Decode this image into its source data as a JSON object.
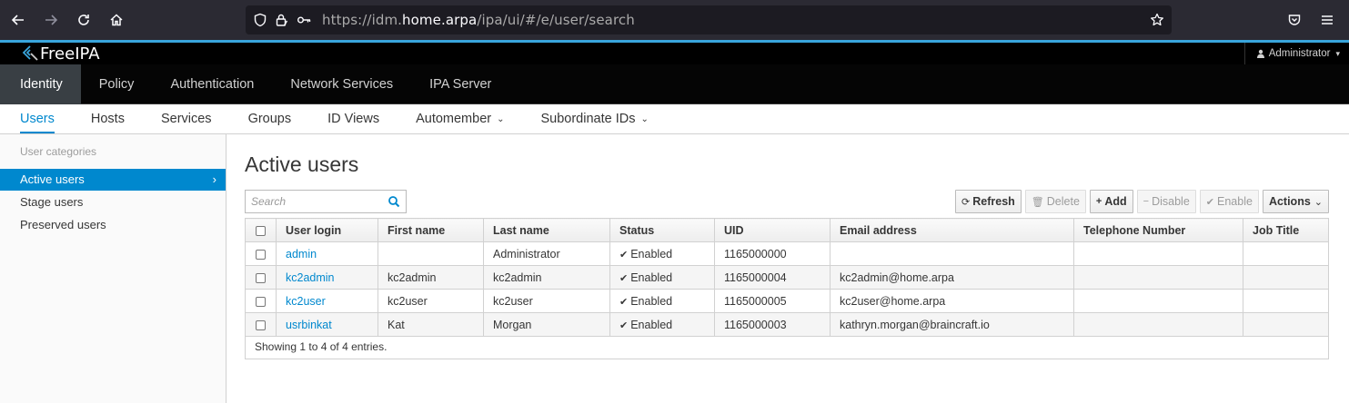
{
  "browser": {
    "url_prefix": "https://idm.",
    "url_domain": "home.arpa",
    "url_path": "/ipa/ui/#/e/user/search"
  },
  "app": {
    "logo_text": "FreeIPA",
    "user_menu": "Administrator"
  },
  "topnav": [
    "Identity",
    "Policy",
    "Authentication",
    "Network Services",
    "IPA Server"
  ],
  "subnav": {
    "users": "Users",
    "hosts": "Hosts",
    "services": "Services",
    "groups": "Groups",
    "id_views": "ID Views",
    "automember": "Automember",
    "subordinate_ids": "Subordinate IDs"
  },
  "sidebar": {
    "category": "User categories",
    "items": [
      "Active users",
      "Stage users",
      "Preserved users"
    ],
    "arrow": "›"
  },
  "main": {
    "title": "Active users",
    "search_placeholder": "Search",
    "toolbar": {
      "refresh": "Refresh",
      "delete": "Delete",
      "add": "Add",
      "disable": "Disable",
      "enable": "Enable",
      "actions": "Actions"
    },
    "columns": [
      "User login",
      "First name",
      "Last name",
      "Status",
      "UID",
      "Email address",
      "Telephone Number",
      "Job Title"
    ],
    "rows": [
      {
        "login": "admin",
        "first": "",
        "last": "Administrator",
        "status": "Enabled",
        "uid": "1165000000",
        "email": "",
        "phone": "",
        "job": ""
      },
      {
        "login": "kc2admin",
        "first": "kc2admin",
        "last": "kc2admin",
        "status": "Enabled",
        "uid": "1165000004",
        "email": "kc2admin@home.arpa",
        "phone": "",
        "job": ""
      },
      {
        "login": "kc2user",
        "first": "kc2user",
        "last": "kc2user",
        "status": "Enabled",
        "uid": "1165000005",
        "email": "kc2user@home.arpa",
        "phone": "",
        "job": ""
      },
      {
        "login": "usrbinkat",
        "first": "Kat",
        "last": "Morgan",
        "status": "Enabled",
        "uid": "1165000003",
        "email": "kathryn.morgan@braincraft.io",
        "phone": "",
        "job": ""
      }
    ],
    "footer": "Showing 1 to 4 of 4 entries."
  },
  "colors": {
    "accent": "#0088ce",
    "header_bg": "#000000",
    "active_nav": "#393f44",
    "brand_line": "#39a5dc"
  }
}
